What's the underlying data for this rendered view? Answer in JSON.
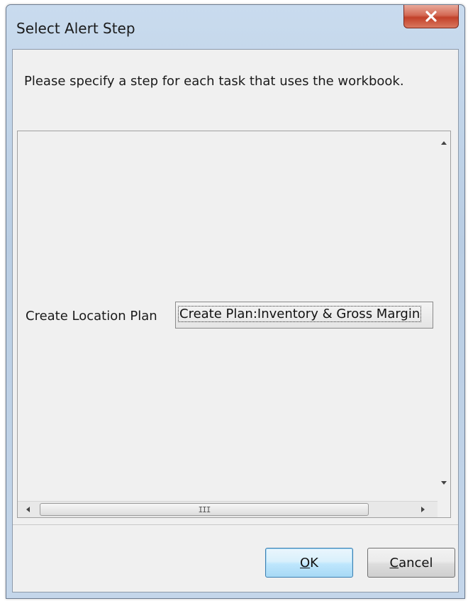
{
  "window": {
    "title": "Select Alert Step"
  },
  "dialog": {
    "instruction": "Please specify a step for each task that uses the workbook.",
    "task": {
      "label": "Create Location Plan",
      "selected_step": "Create Plan:Inventory & Gross Margin"
    },
    "scrollbar": {
      "thumb_grip": "III"
    }
  },
  "buttons": {
    "ok": {
      "mnemonic": "O",
      "rest": "K"
    },
    "cancel": {
      "mnemonic": "C",
      "rest": "ancel"
    }
  },
  "icons": {
    "close": "close-icon",
    "scroll_up": "triangle-up-icon",
    "scroll_down": "triangle-down-icon",
    "scroll_left": "triangle-left-icon",
    "scroll_right": "triangle-right-icon"
  },
  "colors": {
    "titlebar": "#c4d6ea",
    "close_button": "#c2412a",
    "dialog_bg": "#f0f0f0",
    "default_button_border": "#3c7fb1"
  }
}
